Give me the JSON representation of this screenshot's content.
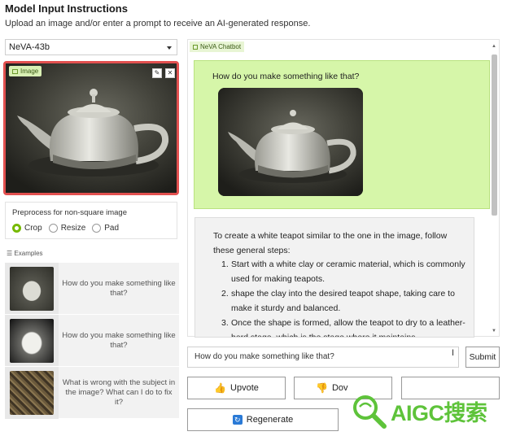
{
  "header": {
    "title": "Model Input Instructions",
    "subtitle": "Upload an image and/or enter a prompt to receive an AI-generated response."
  },
  "model_select": {
    "value": "NeVA-43b"
  },
  "image_panel": {
    "tag": "Image",
    "edit_icon": "pencil-icon",
    "close_icon": "close-icon"
  },
  "preprocess": {
    "label": "Preprocess for non-square image",
    "options": [
      "Crop",
      "Resize",
      "Pad"
    ],
    "selected": "Crop"
  },
  "examples": {
    "label": "Examples",
    "items": [
      {
        "text": "How do you make something like that?"
      },
      {
        "text": "How do you make something like that?"
      },
      {
        "text": "What is wrong with the subject in the image? What can I do to fix it?"
      }
    ]
  },
  "chatbot": {
    "tag": "NeVA Chatbot",
    "user_message": "How do you make something like that?",
    "bot_intro": "To create a white teapot similar to the one in the image, follow these general steps:",
    "bot_steps": [
      {
        "num": "1.",
        "text": "Start with a white clay or ceramic material, which is commonly used for making teapots."
      },
      {
        "num": "2.",
        "text": "shape the clay into the desired teapot shape, taking care to make it sturdy and balanced."
      },
      {
        "num": "3.",
        "text": "Once the shape is formed, allow the teapot to dry to a leather-hard stage, which is the stage where it maintains"
      }
    ]
  },
  "prompt": {
    "value": "How do you make something like that?"
  },
  "buttons": {
    "submit": "Submit",
    "upvote": "Upvote",
    "downvote": "Dov",
    "regenerate": "Regenerate"
  },
  "watermark": {
    "text": "AIGC搜索"
  },
  "colors": {
    "accent": "#76b900",
    "highlight_border": "#e2504f",
    "user_bubble": "#d6f6a9",
    "watermark": "#5ec33a"
  }
}
